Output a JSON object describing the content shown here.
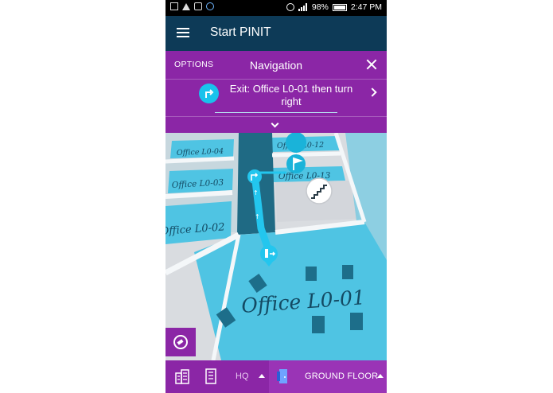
{
  "status_bar": {
    "battery": "98%",
    "time": "2:47 PM"
  },
  "app_bar": {
    "title": "Start PINIT",
    "menu_icon": "hamburger-menu-icon"
  },
  "navigation": {
    "options_label": "OPTIONS",
    "title": "Navigation",
    "close_icon": "close-icon",
    "turn_icon": "turn-right-icon",
    "instruction": "Exit: Office L0-01 then turn right",
    "next_icon": "chevron-right-icon",
    "expand_icon": "chevron-down-icon"
  },
  "map": {
    "rooms": [
      {
        "label": "Office L0-04"
      },
      {
        "label": "Office L0-03"
      },
      {
        "label": "Office L0-02"
      },
      {
        "label": "Office L0-12"
      },
      {
        "label": "Office L0-13"
      },
      {
        "label": "Office L0-01"
      }
    ],
    "destination_icon": "flag-pin-icon",
    "stairs_icon": "stairs-icon",
    "exit_icon": "exit-door-pin-icon",
    "locate_icon": "compass-icon"
  },
  "bottom_bar": {
    "building_label": "HQ",
    "floor_label": "GROUND FLOOR",
    "icons": [
      "buildings-icon",
      "building-icon",
      "floor-door-icon"
    ]
  },
  "colors": {
    "app_bar": "#0d3a57",
    "accent_purple": "#8b26a6",
    "route": "#23c6ee",
    "room_blue": "#4fc4e3"
  }
}
